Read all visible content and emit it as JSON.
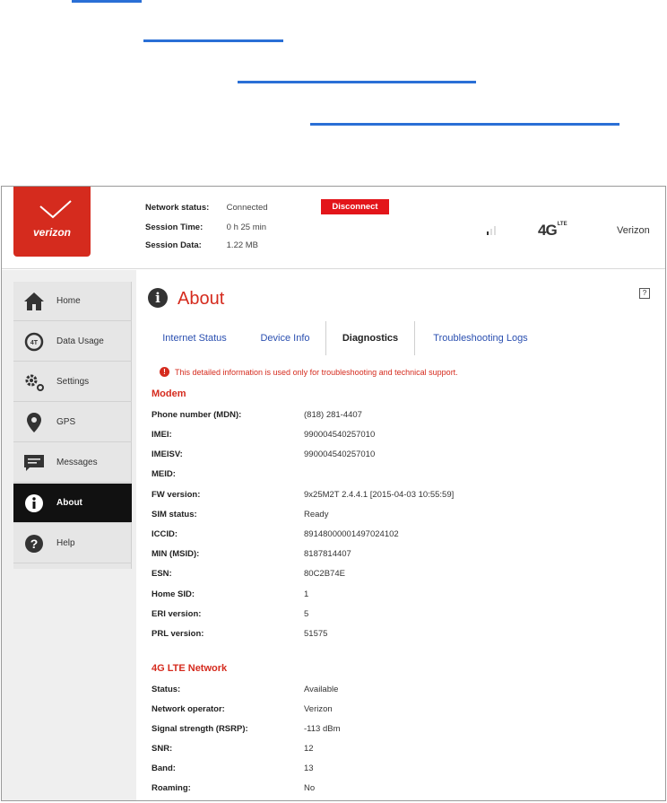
{
  "header": {
    "brand": "verizon",
    "status_labels": {
      "network": "Network status:",
      "session_time": "Session Time:",
      "session_data": "Session Data:"
    },
    "status_values": {
      "network": "Connected",
      "session_time": "0 h 25 min",
      "session_data": "1.22 MB"
    },
    "disconnect_label": "Disconnect",
    "network_type": "4G",
    "network_type_suffix": "LTE",
    "carrier": "Verizon"
  },
  "sidebar": {
    "items": [
      {
        "label": "Home",
        "icon": "home-icon"
      },
      {
        "label": "Data Usage",
        "icon": "data-usage-icon"
      },
      {
        "label": "Settings",
        "icon": "gear-icon"
      },
      {
        "label": "GPS",
        "icon": "location-pin-icon"
      },
      {
        "label": "Messages",
        "icon": "message-icon"
      },
      {
        "label": "About",
        "icon": "info-icon"
      },
      {
        "label": "Help",
        "icon": "question-icon"
      }
    ],
    "active": "About"
  },
  "page": {
    "title": "About",
    "help_icon": "?"
  },
  "tabs": [
    {
      "label": "Internet Status"
    },
    {
      "label": "Device Info"
    },
    {
      "label": "Diagnostics"
    },
    {
      "label": "Troubleshooting Logs"
    }
  ],
  "notice": "This detailed information is used only for troubleshooting and technical support.",
  "modem": {
    "heading": "Modem",
    "rows": [
      {
        "k": "Phone number (MDN):",
        "v": "(818) 281-4407"
      },
      {
        "k": "IMEI:",
        "v": "990004540257010"
      },
      {
        "k": "IMEISV:",
        "v": "990004540257010"
      },
      {
        "k": "MEID:",
        "v": ""
      },
      {
        "k": "FW version:",
        "v": "9x25M2T 2.4.4.1 [2015-04-03 10:55:59]"
      },
      {
        "k": "SIM status:",
        "v": "Ready"
      },
      {
        "k": "ICCID:",
        "v": "89148000001497024102"
      },
      {
        "k": "MIN (MSID):",
        "v": "8187814407"
      },
      {
        "k": "ESN:",
        "v": "80C2B74E"
      },
      {
        "k": "Home SID:",
        "v": "1"
      },
      {
        "k": "ERI version:",
        "v": "5"
      },
      {
        "k": "PRL version:",
        "v": "51575"
      }
    ]
  },
  "lte": {
    "heading": "4G LTE Network",
    "rows": [
      {
        "k": "Status:",
        "v": "Available"
      },
      {
        "k": "Network operator:",
        "v": "Verizon"
      },
      {
        "k": "Signal strength (RSRP):",
        "v": "-113 dBm"
      },
      {
        "k": "SNR:",
        "v": "12"
      },
      {
        "k": "Band:",
        "v": "13"
      },
      {
        "k": "Roaming:",
        "v": "No"
      }
    ]
  }
}
